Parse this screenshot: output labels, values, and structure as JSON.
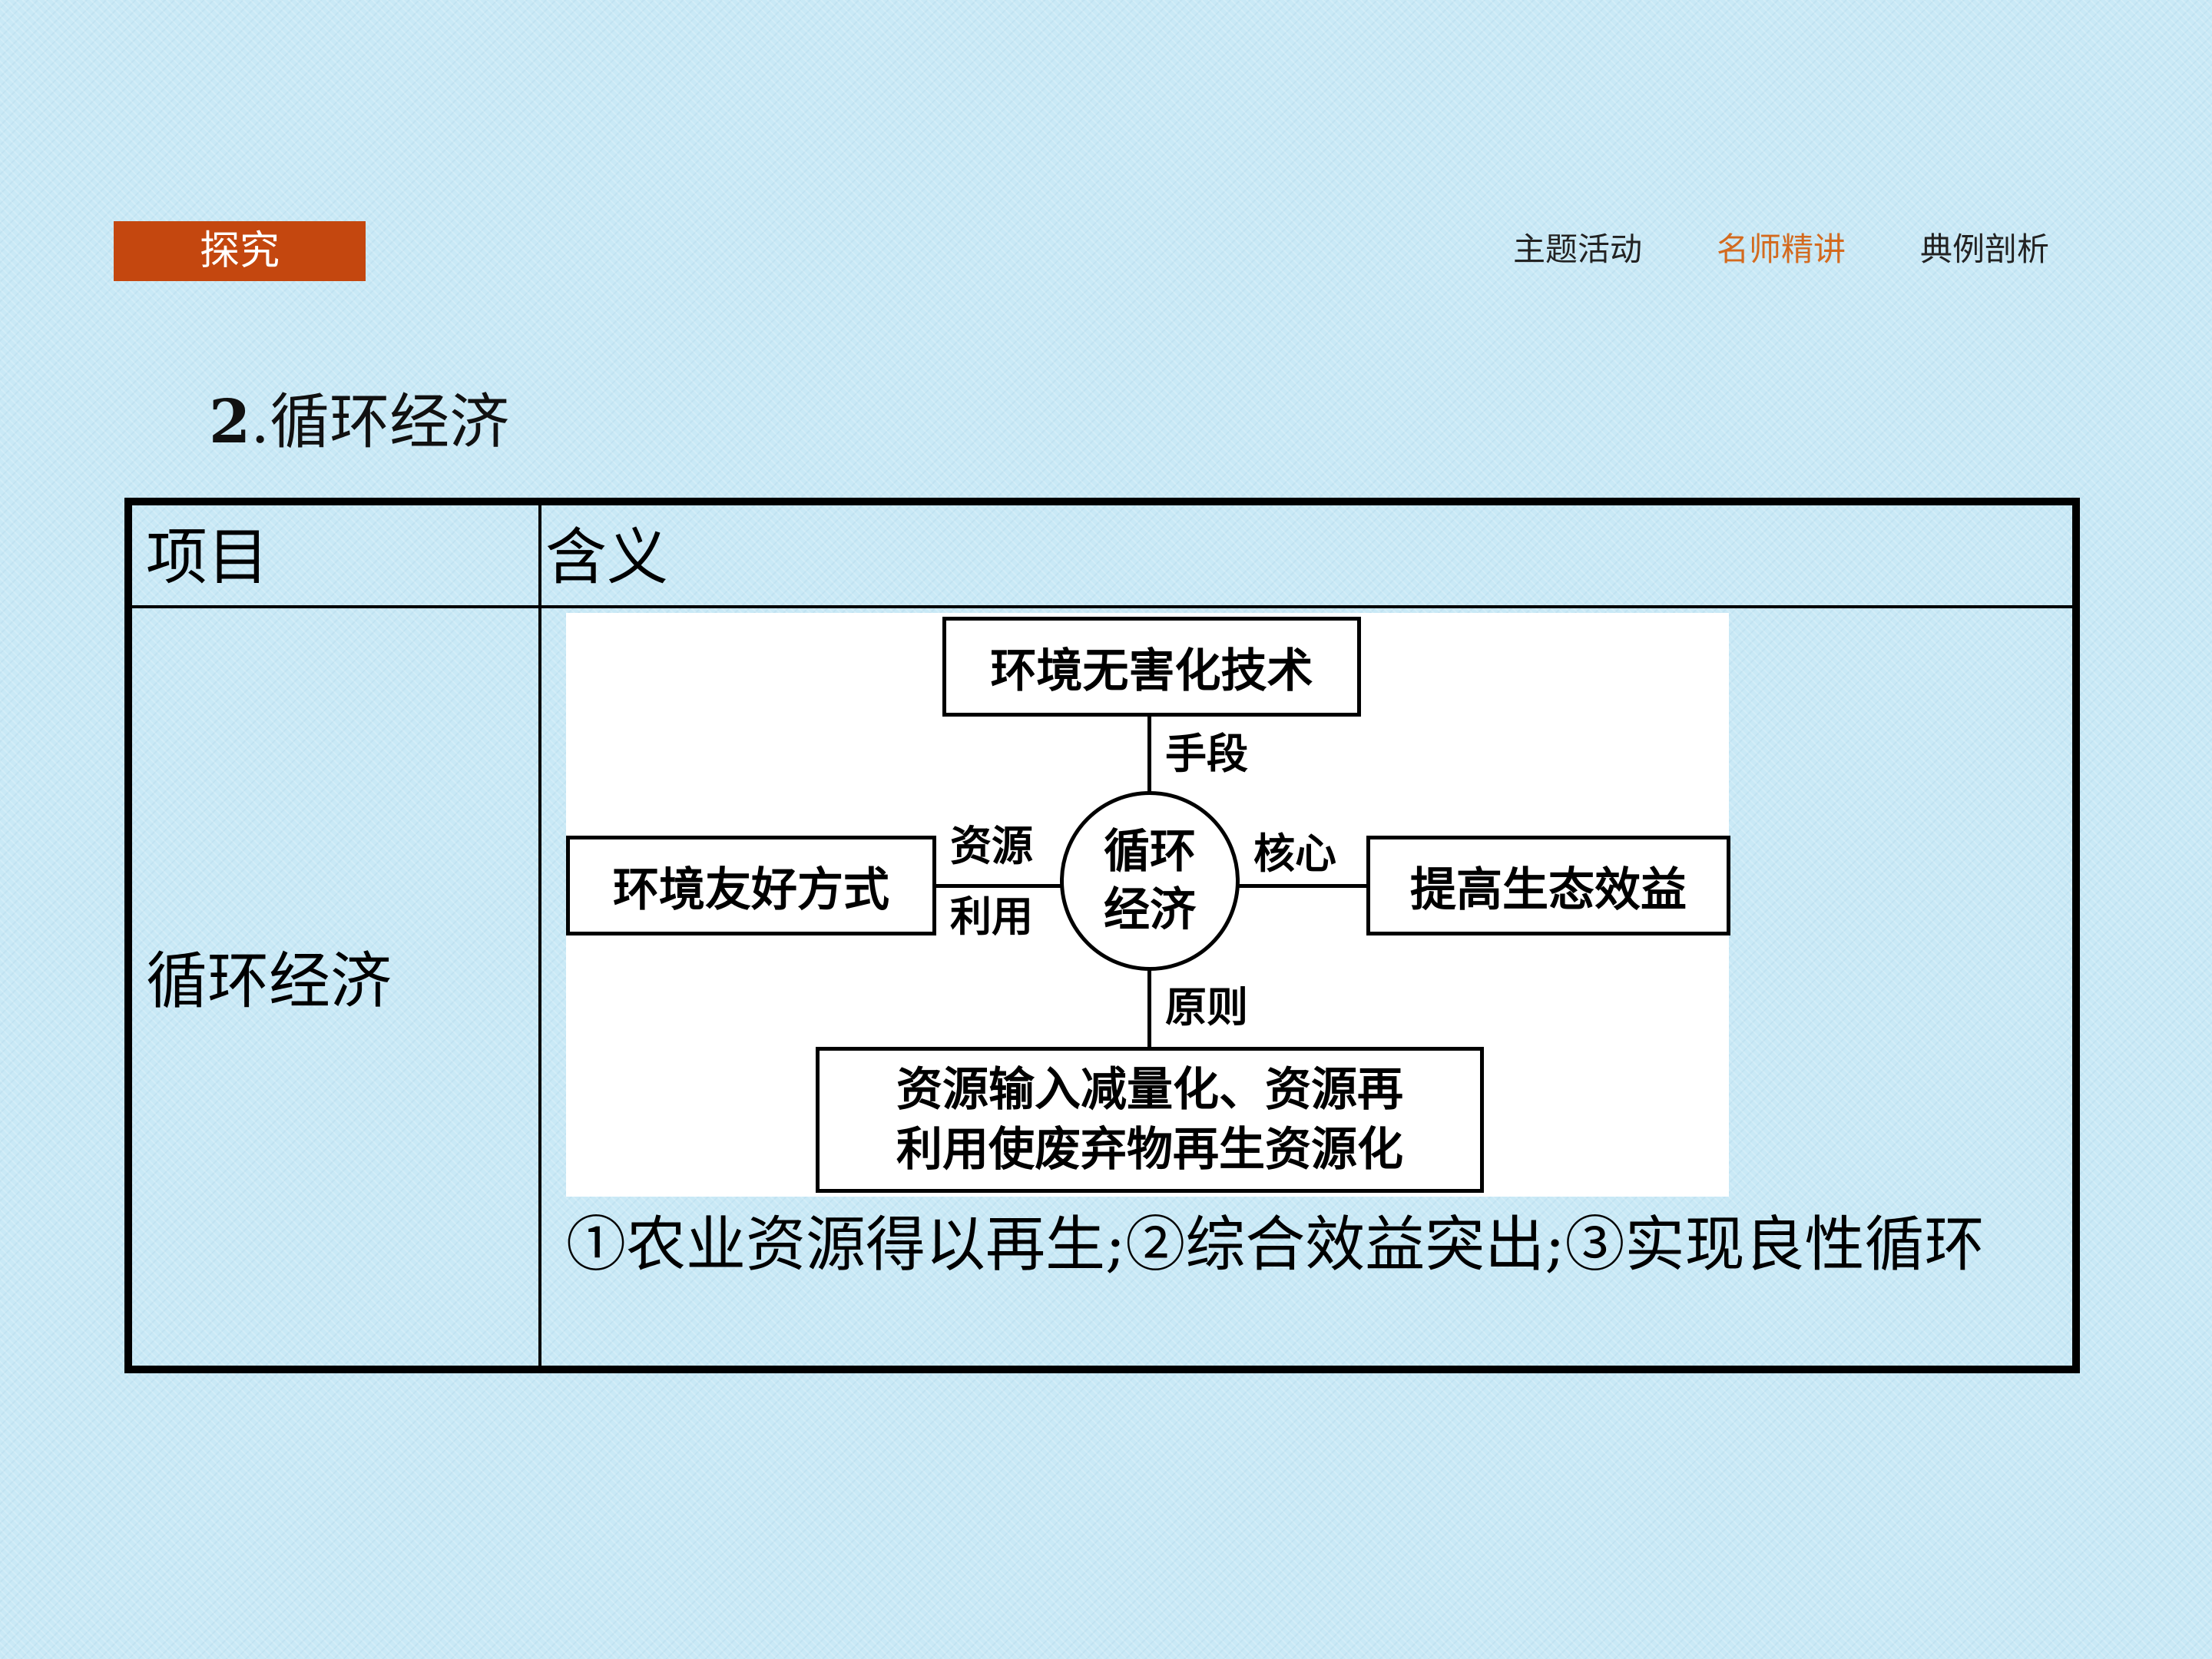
{
  "header": {
    "tag_label": "探究",
    "nav": [
      "主题活动",
      "名师精讲",
      "典例剖析"
    ],
    "active_nav_index": 1,
    "tag_color": "#c4470f",
    "active_color": "#d36a1f"
  },
  "section": {
    "number": "2",
    "title": ".循环经济"
  },
  "table": {
    "headers": [
      "项目",
      "含义"
    ],
    "row_label": "循环经济",
    "diagram": {
      "center": [
        "循环",
        "经济"
      ],
      "top_box": "环境无害化技术",
      "top_label": "手段",
      "left_box": "环境友好方式",
      "left_label": [
        "资源",
        "利用"
      ],
      "right_box": "提高生态效益",
      "right_label": "核心",
      "bottom_box": [
        "资源输入减量化、资源再",
        "利用使废弃物再生资源化"
      ],
      "bottom_label": "原则"
    },
    "description": "①农业资源得以再生;②综合效益突出;③实现良性循环"
  }
}
